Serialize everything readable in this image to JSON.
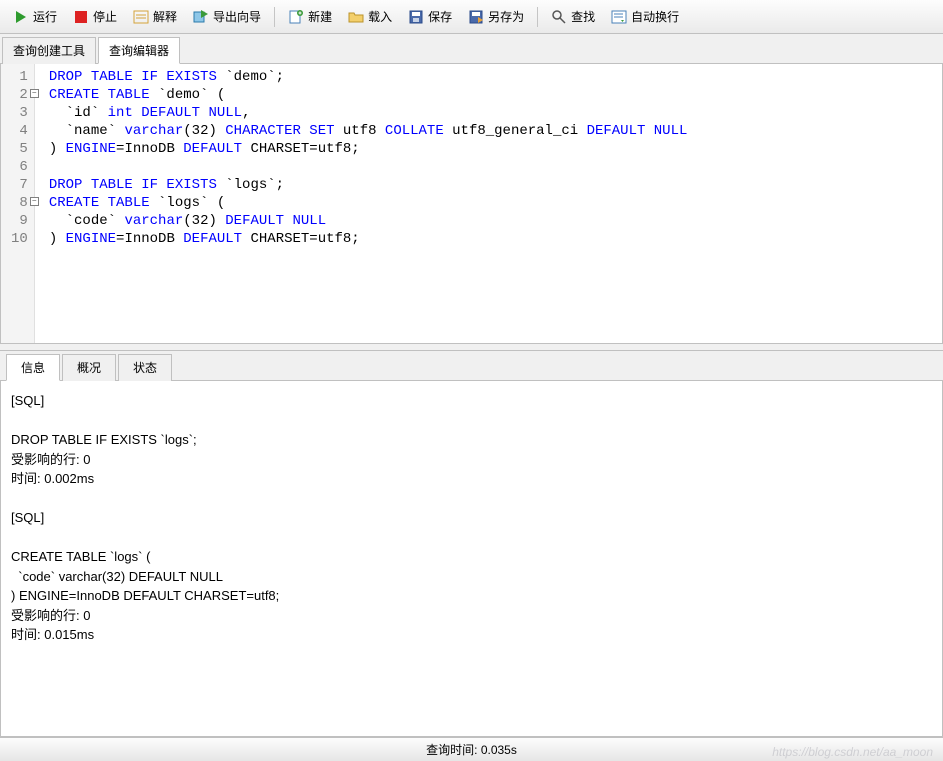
{
  "toolbar": {
    "run": "运行",
    "stop": "停止",
    "explain": "解释",
    "export_wizard": "导出向导",
    "new": "新建",
    "load": "载入",
    "save": "保存",
    "save_as": "另存为",
    "find": "查找",
    "auto_wrap": "自动换行"
  },
  "tabs": {
    "builder": "查询创建工具",
    "editor": "查询编辑器"
  },
  "editor": {
    "lines": [
      {
        "n": "1",
        "fold": false,
        "tokens": [
          {
            "t": "kw",
            "v": "DROP TABLE IF EXISTS "
          },
          {
            "t": "str",
            "v": "`demo`"
          },
          {
            "t": "",
            "v": ";"
          }
        ]
      },
      {
        "n": "2",
        "fold": true,
        "tokens": [
          {
            "t": "kw",
            "v": "CREATE TABLE "
          },
          {
            "t": "str",
            "v": "`demo`"
          },
          {
            "t": "",
            "v": " ("
          }
        ]
      },
      {
        "n": "3",
        "fold": false,
        "tokens": [
          {
            "t": "",
            "v": "  "
          },
          {
            "t": "str",
            "v": "`id`"
          },
          {
            "t": "kw",
            "v": " int DEFAULT NULL"
          },
          {
            "t": "",
            "v": ","
          }
        ]
      },
      {
        "n": "4",
        "fold": false,
        "tokens": [
          {
            "t": "",
            "v": "  "
          },
          {
            "t": "str",
            "v": "`name`"
          },
          {
            "t": "kw",
            "v": " varchar"
          },
          {
            "t": "",
            "v": "(32)"
          },
          {
            "t": "kw",
            "v": " CHARACTER SET "
          },
          {
            "t": "",
            "v": "utf8"
          },
          {
            "t": "kw",
            "v": " COLLATE "
          },
          {
            "t": "",
            "v": "utf8_general_ci"
          },
          {
            "t": "kw",
            "v": " DEFAULT NULL"
          }
        ]
      },
      {
        "n": "5",
        "fold": false,
        "tokens": [
          {
            "t": "",
            "v": ")"
          },
          {
            "t": "kw",
            "v": " ENGINE"
          },
          {
            "t": "",
            "v": "="
          },
          {
            "t": "",
            "v": "InnoDB"
          },
          {
            "t": "kw",
            "v": " DEFAULT "
          },
          {
            "t": "",
            "v": "CHARSET=utf8;"
          }
        ]
      },
      {
        "n": "6",
        "fold": false,
        "tokens": []
      },
      {
        "n": "7",
        "fold": false,
        "tokens": [
          {
            "t": "kw",
            "v": "DROP TABLE IF EXISTS "
          },
          {
            "t": "str",
            "v": "`logs`"
          },
          {
            "t": "",
            "v": ";"
          }
        ]
      },
      {
        "n": "8",
        "fold": true,
        "tokens": [
          {
            "t": "kw",
            "v": "CREATE TABLE "
          },
          {
            "t": "str",
            "v": "`logs`"
          },
          {
            "t": "",
            "v": " ("
          }
        ]
      },
      {
        "n": "9",
        "fold": false,
        "tokens": [
          {
            "t": "",
            "v": "  "
          },
          {
            "t": "str",
            "v": "`code`"
          },
          {
            "t": "kw",
            "v": " varchar"
          },
          {
            "t": "",
            "v": "(32)"
          },
          {
            "t": "kw",
            "v": " DEFAULT NULL"
          }
        ]
      },
      {
        "n": "10",
        "fold": false,
        "tokens": [
          {
            "t": "",
            "v": ")"
          },
          {
            "t": "kw",
            "v": " ENGINE"
          },
          {
            "t": "",
            "v": "="
          },
          {
            "t": "",
            "v": "InnoDB"
          },
          {
            "t": "kw",
            "v": " DEFAULT "
          },
          {
            "t": "",
            "v": "CHARSET=utf8;"
          }
        ]
      }
    ]
  },
  "output_tabs": {
    "info": "信息",
    "profile": "概况",
    "status": "状态"
  },
  "output": {
    "text": "[SQL]\n\nDROP TABLE IF EXISTS `logs`;\n受影响的行: 0\n时间: 0.002ms\n\n[SQL]\n\nCREATE TABLE `logs` (\n  `code` varchar(32) DEFAULT NULL\n) ENGINE=InnoDB DEFAULT CHARSET=utf8;\n受影响的行: 0\n时间: 0.015ms\n"
  },
  "statusbar": {
    "query_time_label": "查询时间: ",
    "query_time_value": "0.035s"
  },
  "watermark": "https://blog.csdn.net/aa_moon"
}
